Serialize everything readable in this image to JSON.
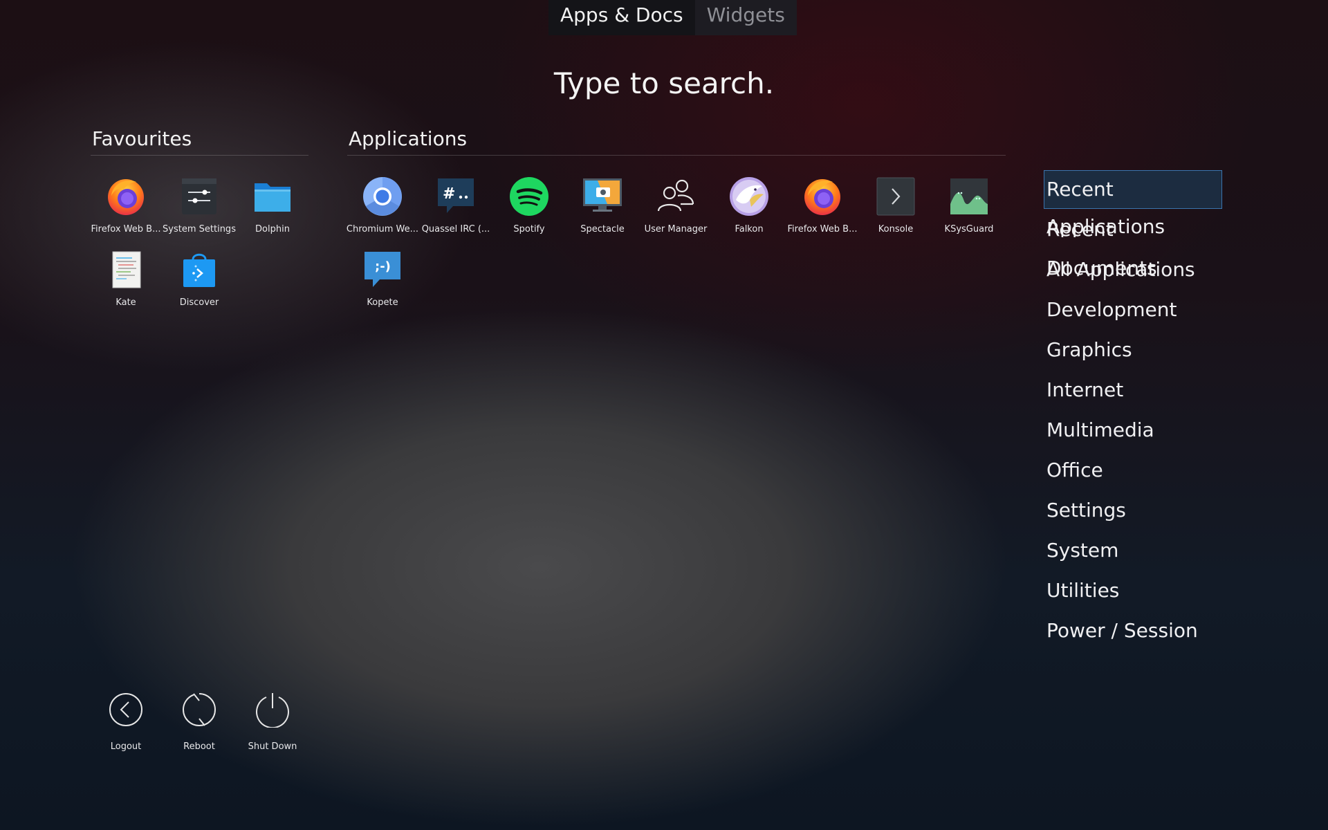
{
  "tabs": {
    "apps_docs": "Apps & Docs",
    "widgets": "Widgets"
  },
  "search_prompt": "Type to search.",
  "favourites": {
    "title": "Favourites",
    "items": [
      {
        "label": "Firefox Web B...",
        "icon": "firefox-icon"
      },
      {
        "label": "System Settings",
        "icon": "system-settings-icon"
      },
      {
        "label": "Dolphin",
        "icon": "folder-icon"
      },
      {
        "label": "Kate",
        "icon": "kate-icon"
      },
      {
        "label": "Discover",
        "icon": "discover-icon"
      }
    ]
  },
  "applications": {
    "title": "Applications",
    "items": [
      {
        "label": "Chromium We...",
        "icon": "chromium-icon"
      },
      {
        "label": "Quassel IRC (...",
        "icon": "quassel-icon"
      },
      {
        "label": "Spotify",
        "icon": "spotify-icon"
      },
      {
        "label": "Spectacle",
        "icon": "spectacle-icon"
      },
      {
        "label": "User Manager",
        "icon": "user-manager-icon"
      },
      {
        "label": "Falkon",
        "icon": "falkon-icon"
      },
      {
        "label": "Firefox Web B...",
        "icon": "firefox-icon"
      },
      {
        "label": "Konsole",
        "icon": "konsole-icon"
      },
      {
        "label": "KSysGuard",
        "icon": "ksysguard-icon"
      },
      {
        "label": "Kopete",
        "icon": "kopete-icon"
      }
    ]
  },
  "categories": {
    "selected": "Recent Applications",
    "items": [
      "Recent Applications",
      "Recent Documents",
      "All Applications",
      "Development",
      "Graphics",
      "Internet",
      "Multimedia",
      "Office",
      "Settings",
      "System",
      "Utilities",
      "Power / Session"
    ]
  },
  "power": {
    "items": [
      {
        "label": "Logout",
        "icon": "logout-icon"
      },
      {
        "label": "Reboot",
        "icon": "reboot-icon"
      },
      {
        "label": "Shut Down",
        "icon": "shutdown-icon"
      }
    ]
  },
  "colors": {
    "selection_bg": "#1c2c40",
    "selection_border": "#3b74ad",
    "accent_blue": "#3daee9"
  }
}
